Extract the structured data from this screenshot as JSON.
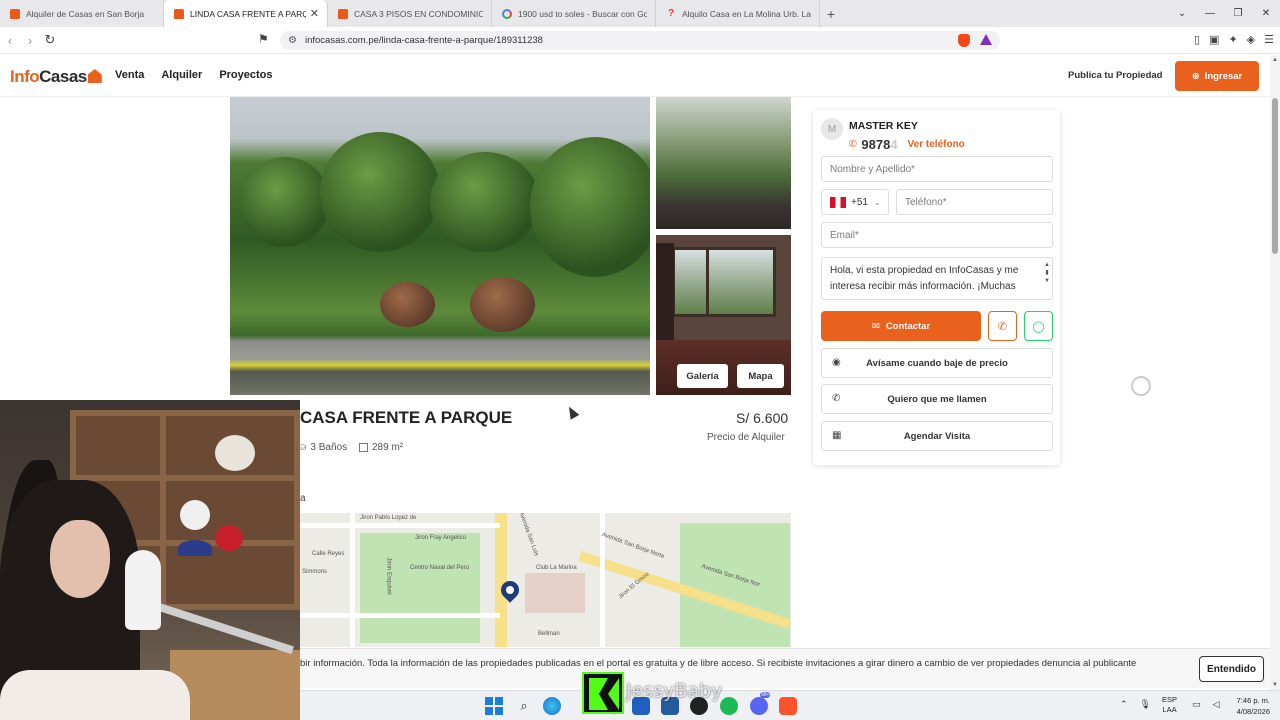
{
  "browser": {
    "tabs": [
      {
        "title": "Alquiler de Casas en San Borja",
        "icon": "infocasas-favicon"
      },
      {
        "title": "LINDA CASA FRENTE A PARQUE",
        "icon": "infocasas-favicon",
        "active": true
      },
      {
        "title": "CASA 3 PISOS EN CONDOMINIO. Re",
        "icon": "infocasas-favicon"
      },
      {
        "title": "1900 usd to soles - Buscar con Goog",
        "icon": "google-favicon"
      },
      {
        "title": "Alquilo Casa en La Molina Urb. La Ens",
        "icon": "question-favicon"
      }
    ],
    "new_tab": "+",
    "url": "infocasas.com.pe/linda-casa-frente-a-parque/189311238"
  },
  "site": {
    "logo_info": "Info",
    "logo_casas": "Casas",
    "nav": [
      "Venta",
      "Alquiler",
      "Proyectos"
    ],
    "publish": "Publica tu Propiedad",
    "login": "Ingresar"
  },
  "gallery": {
    "galeria_btn": "Galería",
    "mapa_btn": "Mapa"
  },
  "listing": {
    "title": "CASA FRENTE A PARQUE",
    "price": "S/ 6.600",
    "price_label": "Precio de Alquiler",
    "baths": "3 Baños",
    "area": "289 m²",
    "location_fragment": "a"
  },
  "map": {
    "labels": [
      "Jiron Pablo Lopez de",
      "Jiron Fray Angelico",
      "Avenida San Luis",
      "Avenida San Borja Norte",
      "Calle Reyes",
      "Centro Naval del Peru",
      "Club La Marina",
      "Jiron El Greco",
      "Bellman",
      "Avenida San Borja Nor",
      "Jiron Esquivel",
      "Simmons"
    ]
  },
  "contact": {
    "agency": "MASTER KEY",
    "avatar_letter": "M",
    "phone_visible": "9878",
    "phone_faded": "4",
    "see_phone": "Ver teléfono",
    "name_placeholder": "Nombre y Apellido*",
    "country_code": "+51",
    "phone_placeholder": "Teléfono*",
    "email_placeholder": "Email*",
    "message": "Hola, vi esta propiedad en InfoCasas y me interesa recibir más información. ¡Muchas",
    "contact_btn": "Contactar",
    "alert_btn": "Avísame cuando baje de precio",
    "callme_btn": "Quiero que me llamen",
    "visit_btn": "Agendar Visita"
  },
  "cookie": {
    "text": "bir información. Toda la información de las propiedades publicadas en el portal es gratuita y de libre acceso. Si recibiste invitaciones a girar dinero a cambio de ver propiedades denuncia al publicante",
    "accept": "Entendido"
  },
  "overlay": {
    "streamer_name": "JessyBaby"
  },
  "taskbar": {
    "lang_line1": "ESP",
    "lang_line2": "LAA",
    "time": "7:46 p. m.",
    "date": "4/08/2026",
    "notification_badge": "99+"
  },
  "colors": {
    "brand_orange": "#e9611d",
    "whatsapp_green": "#25d366",
    "kick_green": "#53fc18"
  }
}
